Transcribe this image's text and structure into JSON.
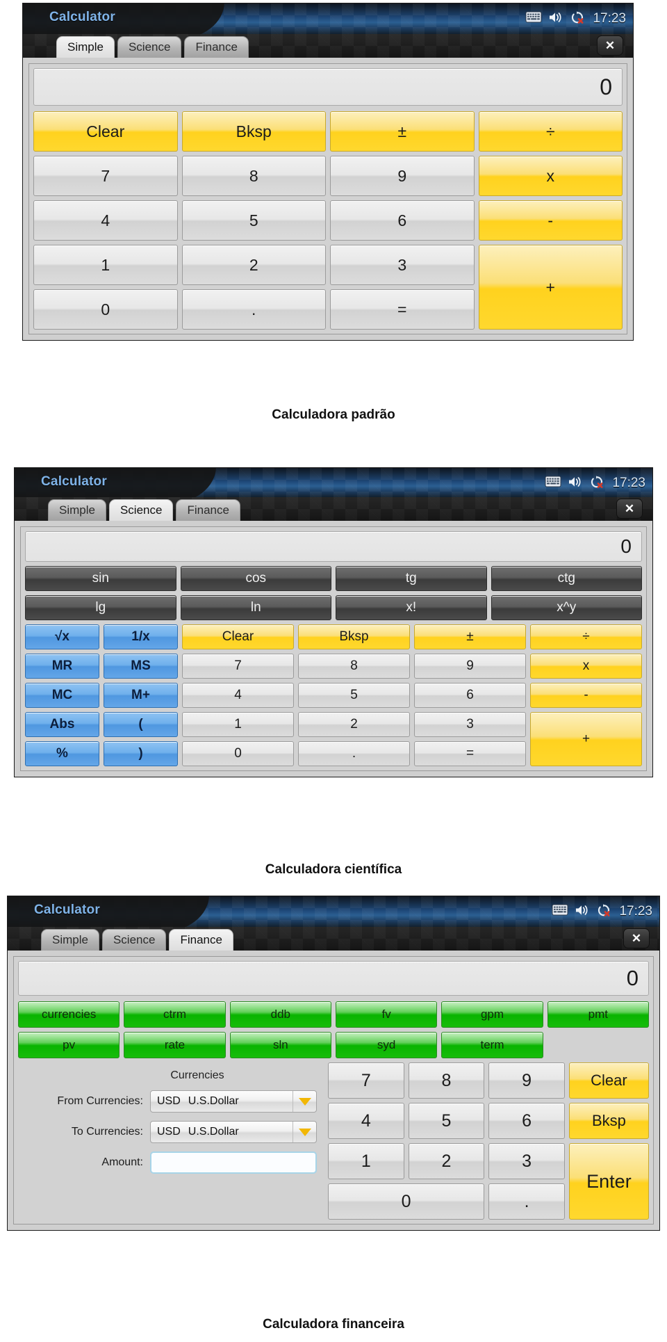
{
  "page": {
    "background": "#ffffff",
    "accent_amber": "#ffd21e",
    "accent_blue": "#4f97e0",
    "accent_green": "#09b400",
    "title_blue": "#7fb3e8"
  },
  "tray": {
    "clock": "17:23",
    "icons": [
      "keyboard-icon",
      "volume-icon",
      "rotation-lock-icon"
    ]
  },
  "window": {
    "app_title": "Calculator",
    "close_label": "✕",
    "tabs": [
      "Simple",
      "Science",
      "Finance"
    ]
  },
  "calculators": [
    {
      "id": "simple",
      "active_tab": "Simple",
      "display_value": "0",
      "caption": "Calculadora padrão",
      "keys": [
        {
          "label": "Clear",
          "style": "amber"
        },
        {
          "label": "Bksp",
          "style": "amber"
        },
        {
          "label": "±",
          "style": "amber"
        },
        {
          "label": "÷",
          "style": "amber"
        },
        {
          "label": "7",
          "style": "num"
        },
        {
          "label": "8",
          "style": "num"
        },
        {
          "label": "9",
          "style": "num"
        },
        {
          "label": "x",
          "style": "amber"
        },
        {
          "label": "4",
          "style": "num"
        },
        {
          "label": "5",
          "style": "num"
        },
        {
          "label": "6",
          "style": "num"
        },
        {
          "label": "-",
          "style": "amber"
        },
        {
          "label": "1",
          "style": "num"
        },
        {
          "label": "2",
          "style": "num"
        },
        {
          "label": "3",
          "style": "num"
        },
        {
          "label": "+",
          "style": "amber",
          "span_rows": 2
        },
        {
          "label": "0",
          "style": "num"
        },
        {
          "label": ".",
          "style": "num"
        },
        {
          "label": "=",
          "style": "num"
        }
      ]
    },
    {
      "id": "science",
      "active_tab": "Science",
      "display_value": "0",
      "caption": "Calculadora científica",
      "functions": [
        {
          "label": "sin",
          "style": "dark"
        },
        {
          "label": "cos",
          "style": "dark"
        },
        {
          "label": "tg",
          "style": "dark"
        },
        {
          "label": "ctg",
          "style": "dark"
        },
        {
          "label": "lg",
          "style": "dark"
        },
        {
          "label": "ln",
          "style": "dark"
        },
        {
          "label": "x!",
          "style": "dark"
        },
        {
          "label": "x^y",
          "style": "dark"
        }
      ],
      "memory": [
        {
          "label": "√x",
          "style": "blue"
        },
        {
          "label": "1/x",
          "style": "blue"
        },
        {
          "label": "MR",
          "style": "blue"
        },
        {
          "label": "MS",
          "style": "blue"
        },
        {
          "label": "MC",
          "style": "blue"
        },
        {
          "label": "M+",
          "style": "blue"
        },
        {
          "label": "Abs",
          "style": "blue"
        },
        {
          "label": "(",
          "style": "blue"
        },
        {
          "label": "%",
          "style": "blue"
        },
        {
          "label": ")",
          "style": "blue"
        }
      ],
      "keys": [
        {
          "label": "Clear",
          "style": "amber"
        },
        {
          "label": "Bksp",
          "style": "amber"
        },
        {
          "label": "±",
          "style": "amber"
        },
        {
          "label": "÷",
          "style": "amber"
        },
        {
          "label": "7",
          "style": "num"
        },
        {
          "label": "8",
          "style": "num"
        },
        {
          "label": "9",
          "style": "num"
        },
        {
          "label": "x",
          "style": "amber"
        },
        {
          "label": "4",
          "style": "num"
        },
        {
          "label": "5",
          "style": "num"
        },
        {
          "label": "6",
          "style": "num"
        },
        {
          "label": "-",
          "style": "amber"
        },
        {
          "label": "1",
          "style": "num"
        },
        {
          "label": "2",
          "style": "num"
        },
        {
          "label": "3",
          "style": "num"
        },
        {
          "label": "+",
          "style": "amber",
          "span_rows": 2
        },
        {
          "label": "0",
          "style": "num"
        },
        {
          "label": ".",
          "style": "num"
        },
        {
          "label": "=",
          "style": "num"
        }
      ]
    },
    {
      "id": "finance",
      "active_tab": "Finance",
      "display_value": "0",
      "caption": "Calculadora financeira",
      "functions": [
        {
          "label": "currencies",
          "style": "green"
        },
        {
          "label": "ctrm",
          "style": "green"
        },
        {
          "label": "ddb",
          "style": "green"
        },
        {
          "label": "fv",
          "style": "green"
        },
        {
          "label": "gpm",
          "style": "green"
        },
        {
          "label": "pmt",
          "style": "green"
        },
        {
          "label": "pv",
          "style": "green"
        },
        {
          "label": "rate",
          "style": "green"
        },
        {
          "label": "sln",
          "style": "green"
        },
        {
          "label": "syd",
          "style": "green"
        },
        {
          "label": "term",
          "style": "green"
        }
      ],
      "currencies_form": {
        "title": "Currencies",
        "from_label": "From Currencies:",
        "from_code": "USD",
        "from_name": "U.S.Dollar",
        "to_label": "To Currencies:",
        "to_code": "USD",
        "to_name": "U.S.Dollar",
        "amount_label": "Amount:",
        "amount_value": "",
        "amount_placeholder": ""
      },
      "keys": [
        {
          "label": "7",
          "style": "num"
        },
        {
          "label": "8",
          "style": "num"
        },
        {
          "label": "9",
          "style": "num"
        },
        {
          "label": "Clear",
          "style": "amber"
        },
        {
          "label": "4",
          "style": "num"
        },
        {
          "label": "5",
          "style": "num"
        },
        {
          "label": "6",
          "style": "num"
        },
        {
          "label": "Bksp",
          "style": "amber"
        },
        {
          "label": "1",
          "style": "num"
        },
        {
          "label": "2",
          "style": "num"
        },
        {
          "label": "3",
          "style": "num"
        },
        {
          "label": "Enter",
          "style": "amber",
          "span_rows": 2
        },
        {
          "label": "0",
          "style": "num",
          "span_cols": 2
        },
        {
          "label": ".",
          "style": "num"
        }
      ]
    }
  ],
  "captions": {
    "c1": "Calculadora padrão",
    "c2": "Calculadora científica",
    "c3": "Calculadora financeira"
  }
}
